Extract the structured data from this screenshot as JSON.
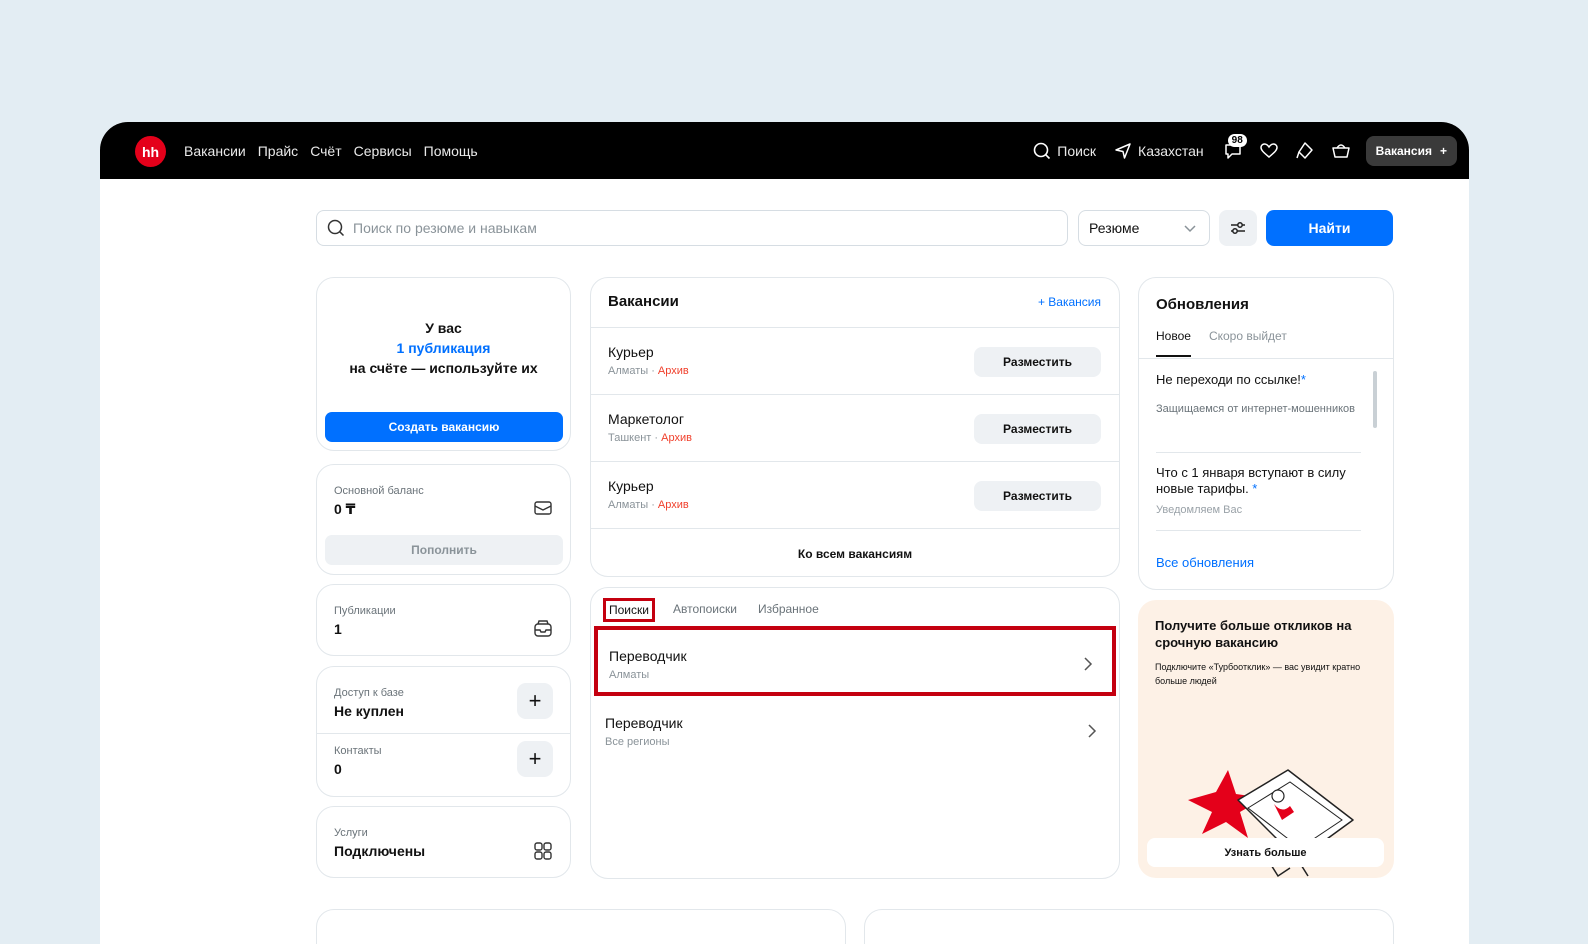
{
  "topbar": {
    "logo": "hh",
    "nav": [
      "Вакансии",
      "Прайс",
      "Счёт",
      "Сервисы",
      "Помощь"
    ],
    "search_label": "Поиск",
    "region_label": "Казахстан",
    "messages_count": "98",
    "vacancy_button": "Вакансия"
  },
  "search": {
    "placeholder": "Поиск по резюме и навыкам",
    "type_value": "Резюме",
    "find_button": "Найти"
  },
  "publications_card": {
    "line1": "У вас",
    "link": "1 публикация",
    "line3": "на счёте — используйте их",
    "create_button": "Создать вакансию"
  },
  "balance": {
    "label": "Основной баланс",
    "value": "0 ₸",
    "topup_button": "Пополнить"
  },
  "publications": {
    "label": "Публикации",
    "value": "1"
  },
  "db_access": {
    "label": "Доступ к базе",
    "value": "Не куплен"
  },
  "contacts": {
    "label": "Контакты",
    "value": "0"
  },
  "services": {
    "label": "Услуги",
    "value": "Подключены"
  },
  "vacancies": {
    "title": "Вакансии",
    "add_link": "+ Вакансия",
    "items": [
      {
        "name": "Курьер",
        "city": "Алматы",
        "status": "Архив",
        "button": "Разместить"
      },
      {
        "name": "Маркетолог",
        "city": "Ташкент",
        "status": "Архив",
        "button": "Разместить"
      },
      {
        "name": "Курьер",
        "city": "Алматы",
        "status": "Архив",
        "button": "Разместить"
      }
    ],
    "all_link": "Ко всем вакансиям"
  },
  "searches": {
    "tabs": [
      "Поиски",
      "Автопоиски",
      "Избранное"
    ],
    "items": [
      {
        "name": "Переводчик",
        "region": "Алматы"
      },
      {
        "name": "Переводчик",
        "region": "Все регионы"
      }
    ]
  },
  "updates": {
    "title": "Обновления",
    "tabs": [
      "Новое",
      "Скоро выйдет"
    ],
    "items": [
      {
        "title": "Не переходи по ссылке!",
        "desc": "Защищаемся от интернет-мошенников"
      },
      {
        "title": "Что с 1 января вступают в силу новые тарифы.",
        "desc": "Уведомляем Вас"
      }
    ],
    "all_link": "Все обновления"
  },
  "promo": {
    "title": "Получите больше откликов на срочную вакансию",
    "text": "Подключите «Турбоотклик» — вас увидит кратно больше людей",
    "button": "Узнать больше"
  },
  "colors": {
    "accent": "#0070ff",
    "brand": "#e4001a",
    "archive": "#f03f2b",
    "highlight": "#c4000f"
  }
}
